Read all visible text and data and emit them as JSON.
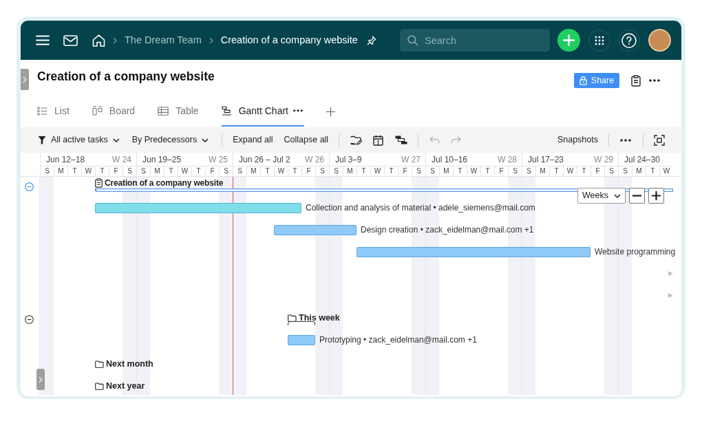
{
  "topbar": {
    "breadcrumbs": [
      {
        "label": "The Dream Team",
        "current": false
      },
      {
        "label": "Creation of a company website",
        "current": true
      }
    ],
    "search": {
      "placeholder": "Search"
    }
  },
  "header": {
    "title": "Creation of a company website",
    "share": "Share"
  },
  "view_tabs": [
    {
      "label": "List",
      "kind": "list",
      "selected": false
    },
    {
      "label": "Board",
      "kind": "board",
      "selected": false
    },
    {
      "label": "Table",
      "kind": "table",
      "selected": false
    },
    {
      "label": "Gantt Chart",
      "kind": "gantt",
      "selected": true
    }
  ],
  "toolbar": {
    "filter": "All active tasks",
    "grouping": "By Predecessors",
    "expand": "Expand all",
    "collapse": "Collapse all",
    "undo": {
      "disabled": true
    },
    "redo": {
      "disabled": true
    },
    "snapshots": "Snapshots"
  },
  "timeline": {
    "weeks": [
      {
        "range": "Jun 12–18",
        "number": "W 24",
        "days": [
          "S",
          "M",
          "T",
          "W",
          "T",
          "F",
          "S"
        ]
      },
      {
        "range": "Jun 19–25",
        "number": "W 25",
        "days": [
          "S",
          "M",
          "T",
          "W",
          "T",
          "F",
          "S"
        ]
      },
      {
        "range": "Jun 26 – Jul 2",
        "number": "W 26",
        "days": [
          "S",
          "M",
          "T",
          "W",
          "T",
          "F",
          "S"
        ]
      },
      {
        "range": "Jul 3–9",
        "number": "W 27",
        "days": [
          "S",
          "M",
          "T",
          "W",
          "T",
          "F",
          "S"
        ]
      },
      {
        "range": "Jul 10–16",
        "number": "W 28",
        "days": [
          "S",
          "M",
          "T",
          "W",
          "T",
          "F",
          "S"
        ]
      },
      {
        "range": "Jul 17–23",
        "number": "W 29",
        "days": [
          "S",
          "M",
          "T",
          "W",
          "T",
          "F",
          "S"
        ]
      },
      {
        "range": "Jul 24–30",
        "days": [
          "S",
          "M",
          "T",
          "W"
        ]
      }
    ]
  },
  "zoom": {
    "scale": "Weeks"
  },
  "rows": [
    {
      "kind": "project",
      "label": "Creation of a company website",
      "expanded": true
    },
    {
      "kind": "task",
      "label": "Collection and analysis of material • adele_siemens@mail.com",
      "color": "#80deea"
    },
    {
      "kind": "task",
      "label": "Design creation • zack_eidelman@mail.com +1",
      "color": "#90caf9"
    },
    {
      "kind": "task",
      "label": "Website programming",
      "color": "#90caf9"
    },
    {
      "kind": "offscreen",
      "marker": "▶"
    },
    {
      "kind": "offscreen",
      "marker": "▶"
    },
    {
      "kind": "group",
      "label": "This week",
      "expanded": true
    },
    {
      "kind": "task",
      "label": "Prototyping • zack_eidelman@mail.com +1",
      "color": "#90caf9"
    },
    {
      "kind": "group",
      "label": "Next month"
    },
    {
      "kind": "group",
      "label": "Next year"
    }
  ]
}
